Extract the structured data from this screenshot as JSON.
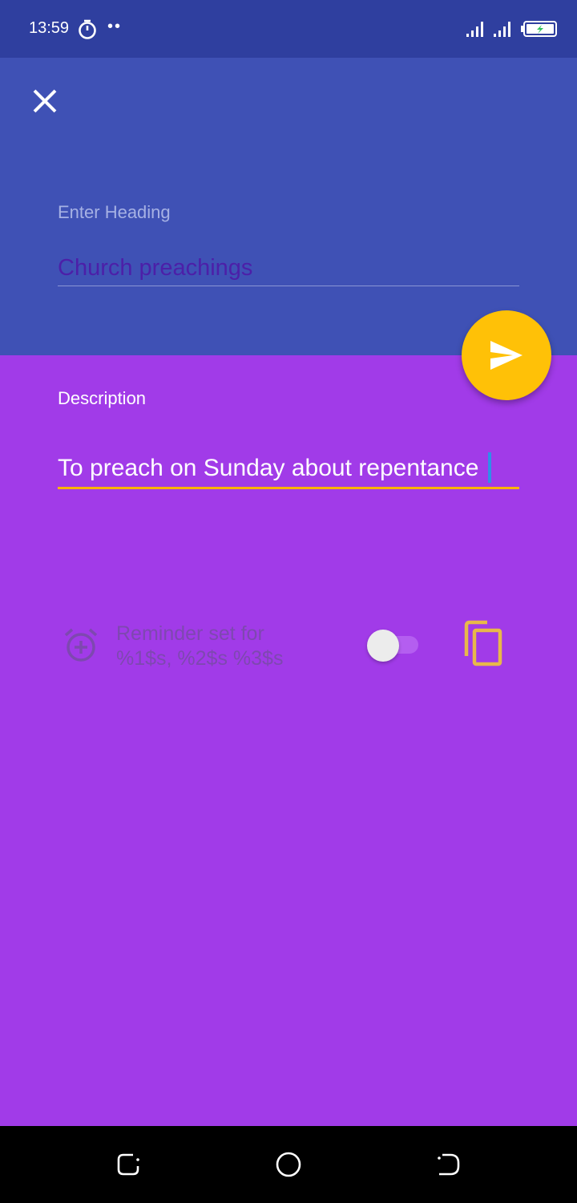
{
  "status_bar": {
    "time": "13:59",
    "dots": "••",
    "icons": [
      "timer-icon",
      "signal-icon",
      "signal-icon",
      "battery-charging-icon"
    ]
  },
  "header": {
    "close_icon": "close-icon",
    "heading_label": "Enter Heading",
    "heading_value": "Church preachings"
  },
  "fab": {
    "icon": "send-icon"
  },
  "description": {
    "label": "Description",
    "value": "To preach on Sunday about repentance"
  },
  "reminder": {
    "icon": "alarm-add-icon",
    "text_line1": "Reminder set for",
    "text_line2": "%1$s, %2$s %3$s",
    "toggle_on": false
  },
  "copy": {
    "icon": "copy-icon"
  },
  "nav_bar": {
    "icons": [
      "recent-apps-icon",
      "home-icon",
      "back-icon"
    ]
  },
  "colors": {
    "status_bar": "#2f3f9f",
    "header": "#3f51b5",
    "body": "#a13be8",
    "accent": "#ffc107",
    "heading_text": "#4c1fa8"
  }
}
